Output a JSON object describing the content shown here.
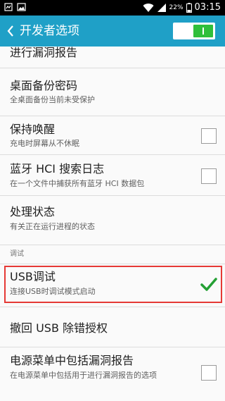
{
  "status_bar": {
    "battery_percent": "22%",
    "time": "03:15",
    "icons": [
      "notification-icon",
      "image-icon",
      "wifi-icon",
      "signal-icon",
      "battery-icon"
    ]
  },
  "header": {
    "title": "开发者选项",
    "master_switch_on": true,
    "accent_color": "#1fa0c7"
  },
  "settings": {
    "bug_report": {
      "title": "进行漏洞报告"
    },
    "backup_password": {
      "title": "桌面备份密码",
      "subtitle": "全桌面备份当前未受保护"
    },
    "stay_awake": {
      "title": "保持唤醒",
      "subtitle": "充电时屏幕从不休眠",
      "checked": false
    },
    "bt_hci_log": {
      "title": "蓝牙 HCI 搜索日志",
      "subtitle": "在一个文件中捕获所有蓝牙 HCI 数据包",
      "checked": false
    },
    "process_stats": {
      "title": "处理状态",
      "subtitle": "有关正在运行进程的状态"
    },
    "debug_section": {
      "label": "调试"
    },
    "usb_debugging": {
      "title": "USB调试",
      "subtitle": "连接USB时调试模式启动",
      "checked": true
    },
    "revoke_usb": {
      "title": "撤回 USB 除错授权"
    },
    "power_menu_bug": {
      "title": "电源菜单中包括漏洞报告",
      "subtitle": "在电源菜单中包括用于进行漏洞报告的选项",
      "checked": false
    }
  }
}
